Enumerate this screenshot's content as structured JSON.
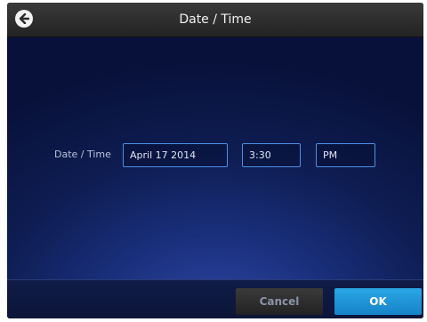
{
  "header": {
    "title": "Date / Time"
  },
  "form": {
    "label": "Date / Time",
    "date_value": "April 17 2014",
    "time_value": "3:30",
    "ampm_value": "PM"
  },
  "footer": {
    "cancel_label": "Cancel",
    "ok_label": "OK"
  },
  "colors": {
    "field_border": "#4d8fe6",
    "ok_button": "#1f95d8",
    "background": "#1a2f7c"
  }
}
